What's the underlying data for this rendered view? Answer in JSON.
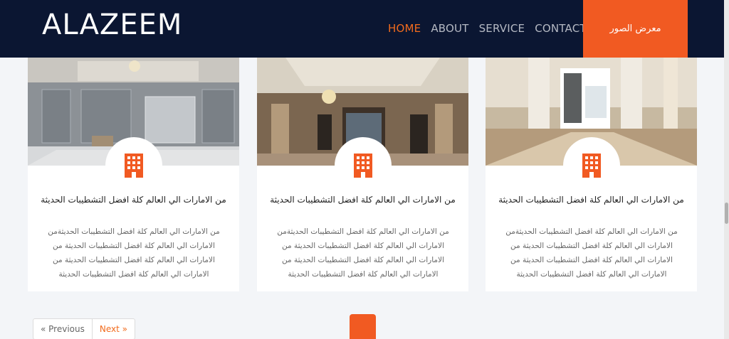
{
  "brand": {
    "name": "ALAZEEM"
  },
  "nav": {
    "items": [
      {
        "label": "HOME",
        "active": true
      },
      {
        "label": "ABOUT",
        "active": false
      },
      {
        "label": "SERVICE",
        "active": false
      },
      {
        "label": "CONTACT",
        "active": false
      }
    ],
    "gallery_button": "معرض الصور"
  },
  "colors": {
    "accent": "#f15a22",
    "nav_bg": "#0b1632",
    "page_bg": "#f3f5f8"
  },
  "cards": [
    {
      "icon": "building-icon",
      "title": "من الامارات الي العالم كلة افضل التشطيبات الحديثة",
      "text": "من الامارات الي العالم كلة افضل التشطيبات الحديثةمن الامارات الي العالم كلة افضل التشطيبات الحديثة من الامارات الي العالم كلة افضل التشطيبات الحديثة من الامارات الي العالم كلة افضل التشطيبات الحديثة"
    },
    {
      "icon": "building-icon",
      "title": "من الامارات الي العالم كلة افضل التشطيبات الحديثة",
      "text": "من الامارات الي العالم كلة افضل التشطيبات الحديثةمن الامارات الي العالم كلة افضل التشطيبات الحديثة من الامارات الي العالم كلة افضل التشطيبات الحديثة من الامارات الي العالم كلة افضل التشطيبات الحديثة"
    },
    {
      "icon": "building-icon",
      "title": "من الامارات الي العالم كلة افضل التشطيبات الحديثة",
      "text": "من الامارات الي العالم كلة افضل التشطيبات الحديثةمن الامارات الي العالم كلة افضل التشطيبات الحديثة من الامارات الي العالم كلة افضل التشطيبات الحديثة من الامارات الي العالم كلة افضل التشطيبات الحديثة"
    }
  ],
  "pagination": {
    "previous": "« Previous",
    "next": "Next »"
  }
}
